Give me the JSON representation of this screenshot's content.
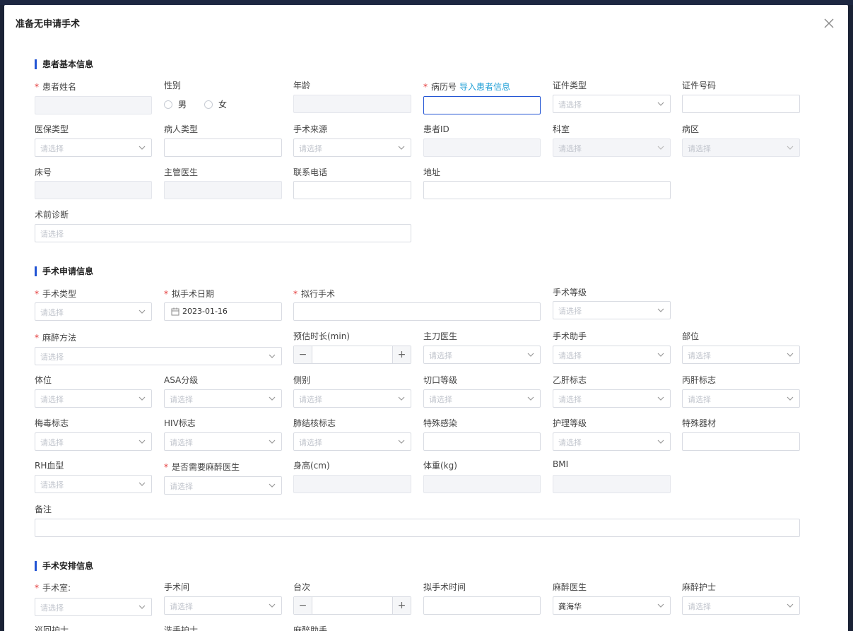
{
  "dialog": {
    "title": "准备无申请手术"
  },
  "ui": {
    "placeholder": "请选择",
    "import_link": "导入患者信息"
  },
  "sections": {
    "patient": "患者基本信息",
    "apply": "手术申请信息",
    "arrange": "手术安排信息"
  },
  "patient": {
    "name": "患者姓名",
    "gender": "性别",
    "male": "男",
    "female": "女",
    "age": "年龄",
    "record_no": "病历号",
    "id_type": "证件类型",
    "id_no": "证件号码",
    "insurance": "医保类型",
    "patient_type": "病人类型",
    "source": "手术来源",
    "patient_id": "患者ID",
    "dept": "科室",
    "ward": "病区",
    "bed": "床号",
    "doctor": "主管医生",
    "phone": "联系电话",
    "address": "地址",
    "diagnosis": "术前诊断"
  },
  "apply": {
    "op_type": "手术类型",
    "op_date": "拟手术日期",
    "op_date_value": "2023-01-16",
    "op_name": "拟行手术",
    "op_level": "手术等级",
    "anes_method": "麻醉方法",
    "duration": "预估时长(min)",
    "surgeon": "主刀医生",
    "assistant": "手术助手",
    "site": "部位",
    "position": "体位",
    "asa": "ASA分级",
    "side": "侧别",
    "incision": "切口等级",
    "hbv": "乙肝标志",
    "hcv": "丙肝标志",
    "syphilis": "梅毒标志",
    "hiv": "HIV标志",
    "tb": "肺结核标志",
    "infection": "特殊感染",
    "nursing": "护理等级",
    "equipment": "特殊器材",
    "rh": "RH血型",
    "need_anes": "是否需要麻醉医生",
    "height": "身高(cm)",
    "weight": "体重(kg)",
    "bmi": "BMI",
    "remark": "备注"
  },
  "arrange": {
    "room": "手术室:",
    "room2": "手术间",
    "order": "台次",
    "time": "拟手术时间",
    "anes_doctor": "麻醉医生",
    "anes_doctor_value": "龚海华",
    "anes_nurse": "麻醉护士",
    "circ_nurse": "巡回护士",
    "scrub_nurse": "洗手护士",
    "anes_assistant": "麻醉助手"
  }
}
